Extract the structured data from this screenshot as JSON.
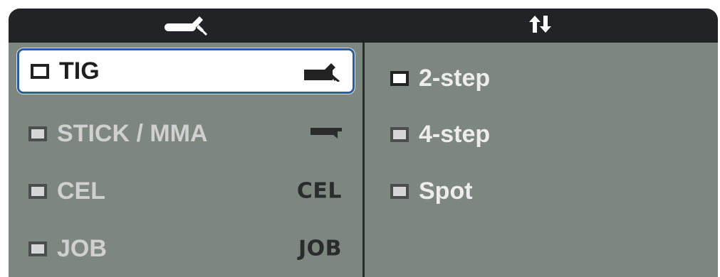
{
  "header": {
    "left_icon": "tig-torch-icon",
    "right_icon": "trigger-mode-arrows-icon"
  },
  "process_list": {
    "items": [
      {
        "label": "TIG",
        "icon": "tig-torch-icon",
        "selected": true
      },
      {
        "label": "STICK / MMA",
        "icon": "stick-electrode-holder-icon",
        "selected": false
      },
      {
        "label": "CEL",
        "icon_text": "CEL",
        "selected": false
      },
      {
        "label": "JOB",
        "icon_text": "JOB",
        "selected": false
      }
    ]
  },
  "trigger_list": {
    "items": [
      {
        "label": "2-step",
        "active": true
      },
      {
        "label": "4-step",
        "active": false
      },
      {
        "label": "Spot",
        "active": false
      }
    ]
  },
  "colors": {
    "panel": "#7e8680",
    "header": "#222326",
    "selection_border": "#2c5d96",
    "label_inactive": "#d0d0d0"
  }
}
